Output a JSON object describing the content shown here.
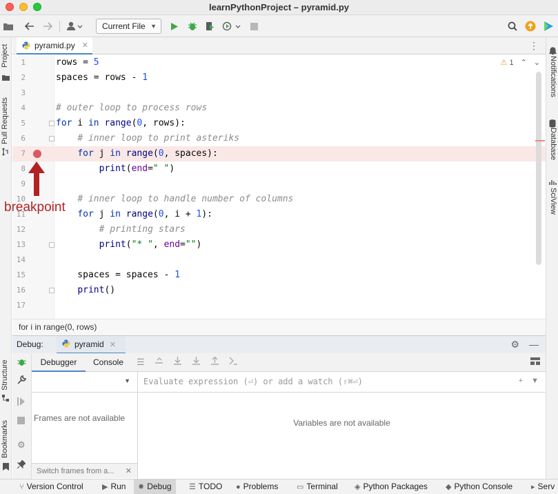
{
  "window": {
    "title": "learnPythonProject – pyramid.py"
  },
  "toolbar": {
    "run_config": "Current File"
  },
  "left_strip": {
    "project": "Project",
    "pull_requests": "Pull Requests",
    "structure": "Structure",
    "bookmarks": "Bookmarks"
  },
  "right_strip": {
    "notifications": "Notifications",
    "database": "Database",
    "sciview": "SciView"
  },
  "editor_tab": {
    "filename": "pyramid.py"
  },
  "inspection": {
    "warnings": "1"
  },
  "lines": [
    {
      "num": "1"
    },
    {
      "num": "2"
    },
    {
      "num": "3"
    },
    {
      "num": "4"
    },
    {
      "num": "5"
    },
    {
      "num": "6"
    },
    {
      "num": "7"
    },
    {
      "num": "8"
    },
    {
      "num": "9"
    },
    {
      "num": "10"
    },
    {
      "num": "11"
    },
    {
      "num": "12"
    },
    {
      "num": "13"
    },
    {
      "num": "14"
    },
    {
      "num": "15"
    },
    {
      "num": "16"
    },
    {
      "num": "17"
    }
  ],
  "annotation": {
    "label": "breakpoint"
  },
  "breadcrumb": {
    "text": "for i in range(0, rows)"
  },
  "debug": {
    "label": "Debug:",
    "session": "pyramid",
    "tabs": {
      "debugger": "Debugger",
      "console": "Console"
    },
    "frames_empty": "Frames are not available",
    "switch_frames": "Switch frames from a...",
    "eval_placeholder": "Evaluate expression (⏎) or add a watch (⇧⌘⏎)",
    "vars_empty": "Variables are not available"
  },
  "statusbar": {
    "version_control": "Version Control",
    "run": "Run",
    "debug": "Debug",
    "todo": "TODO",
    "problems": "Problems",
    "terminal": "Terminal",
    "python_packages": "Python Packages",
    "python_console": "Python Console",
    "services": "Serv"
  }
}
